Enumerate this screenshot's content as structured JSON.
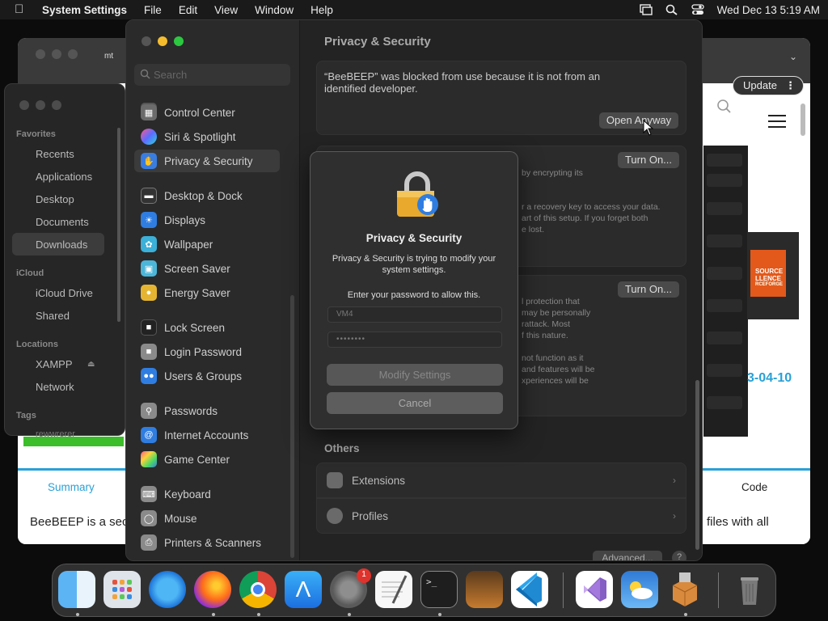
{
  "menubar": {
    "app_name": "System Settings",
    "items": [
      "File",
      "Edit",
      "View",
      "Window",
      "Help"
    ],
    "clock": "Wed Dec 13  5:19 AM"
  },
  "browser": {
    "tab_label": "mt",
    "update_label": "Update",
    "tab_summary": "Summary",
    "tab_code": "Code",
    "body_left": "BeeBEEP is a sec",
    "body_right": "files with all",
    "version_date": "3-04-10",
    "badge_text_1": "SOURCE",
    "badge_text_2": "LLENCE",
    "badge_text_3": "RCEFORGE"
  },
  "finder": {
    "favorites_title": "Favorites",
    "favorites": [
      "Recents",
      "Applications",
      "Desktop",
      "Documents",
      "Downloads"
    ],
    "icloud_title": "iCloud",
    "icloud": [
      "iCloud Drive",
      "Shared"
    ],
    "locations_title": "Locations",
    "locations": [
      "XAMPP",
      "Network"
    ],
    "tags_title": "Tags",
    "tag_partial": "rewwrerer"
  },
  "settings": {
    "search_placeholder": "Search",
    "sidebar": [
      {
        "label": "Control Center",
        "color": "#6b6b6b"
      },
      {
        "label": "Siri & Spotlight",
        "color": "#b246c9"
      },
      {
        "label": "Privacy & Security",
        "color": "#3a7de0"
      },
      {
        "label": "Desktop & Dock",
        "color": "#333333"
      },
      {
        "label": "Displays",
        "color": "#2f7de1"
      },
      {
        "label": "Wallpaper",
        "color": "#3bb0d8"
      },
      {
        "label": "Screen Saver",
        "color": "#4cb6d9"
      },
      {
        "label": "Energy Saver",
        "color": "#e5b532"
      },
      {
        "label": "Lock Screen",
        "color": "#222222"
      },
      {
        "label": "Login Password",
        "color": "#8a8a8a"
      },
      {
        "label": "Users & Groups",
        "color": "#2f7de1"
      },
      {
        "label": "Passwords",
        "color": "#8a8a8a"
      },
      {
        "label": "Internet Accounts",
        "color": "#2f7de1"
      },
      {
        "label": "Game Center",
        "color": "#e04a8a"
      },
      {
        "label": "Keyboard",
        "color": "#8a8a8a"
      },
      {
        "label": "Mouse",
        "color": "#8a8a8a"
      },
      {
        "label": "Printers & Scanners",
        "color": "#8a8a8a"
      }
    ],
    "title": "Privacy & Security",
    "blocked_message": "“BeeBEEP” was blocked from use because it is not from an identified developer.",
    "open_anyway": "Open Anyway",
    "turn_on_1": "Turn On...",
    "turn_on_2": "Turn On...",
    "filevault_lines": [
      "by encrypting its",
      "",
      "",
      "r a recovery key to access your data.",
      "art of this setup. If you forget both",
      "e lost."
    ],
    "lockdown_lines": [
      "l protection that",
      "may be personally",
      "rattack. Most",
      "f this nature.",
      "",
      "not function as it",
      "and features will be",
      "xperiences will be"
    ],
    "others_title": "Others",
    "others": [
      "Extensions",
      "Profiles"
    ],
    "advanced": "Advanced...",
    "help": "?"
  },
  "dialog": {
    "title": "Privacy & Security",
    "subtitle": "Privacy & Security is trying to modify your system settings.",
    "prompt": "Enter your password to allow this.",
    "username": "VM4",
    "password_mask": "••••••••",
    "primary": "Modify Settings",
    "cancel": "Cancel"
  },
  "dock": {
    "badge_count": "1",
    "apps": [
      "finder-icon",
      "launchpad-icon",
      "safari-icon",
      "firefox-icon",
      "chrome-icon",
      "app-store-icon",
      "system-settings-icon",
      "textedit-icon",
      "terminal-icon",
      "garageband-icon",
      "vscode-icon",
      "visual-studio-icon",
      "weather-icon",
      "package-icon",
      "trash-icon"
    ]
  }
}
